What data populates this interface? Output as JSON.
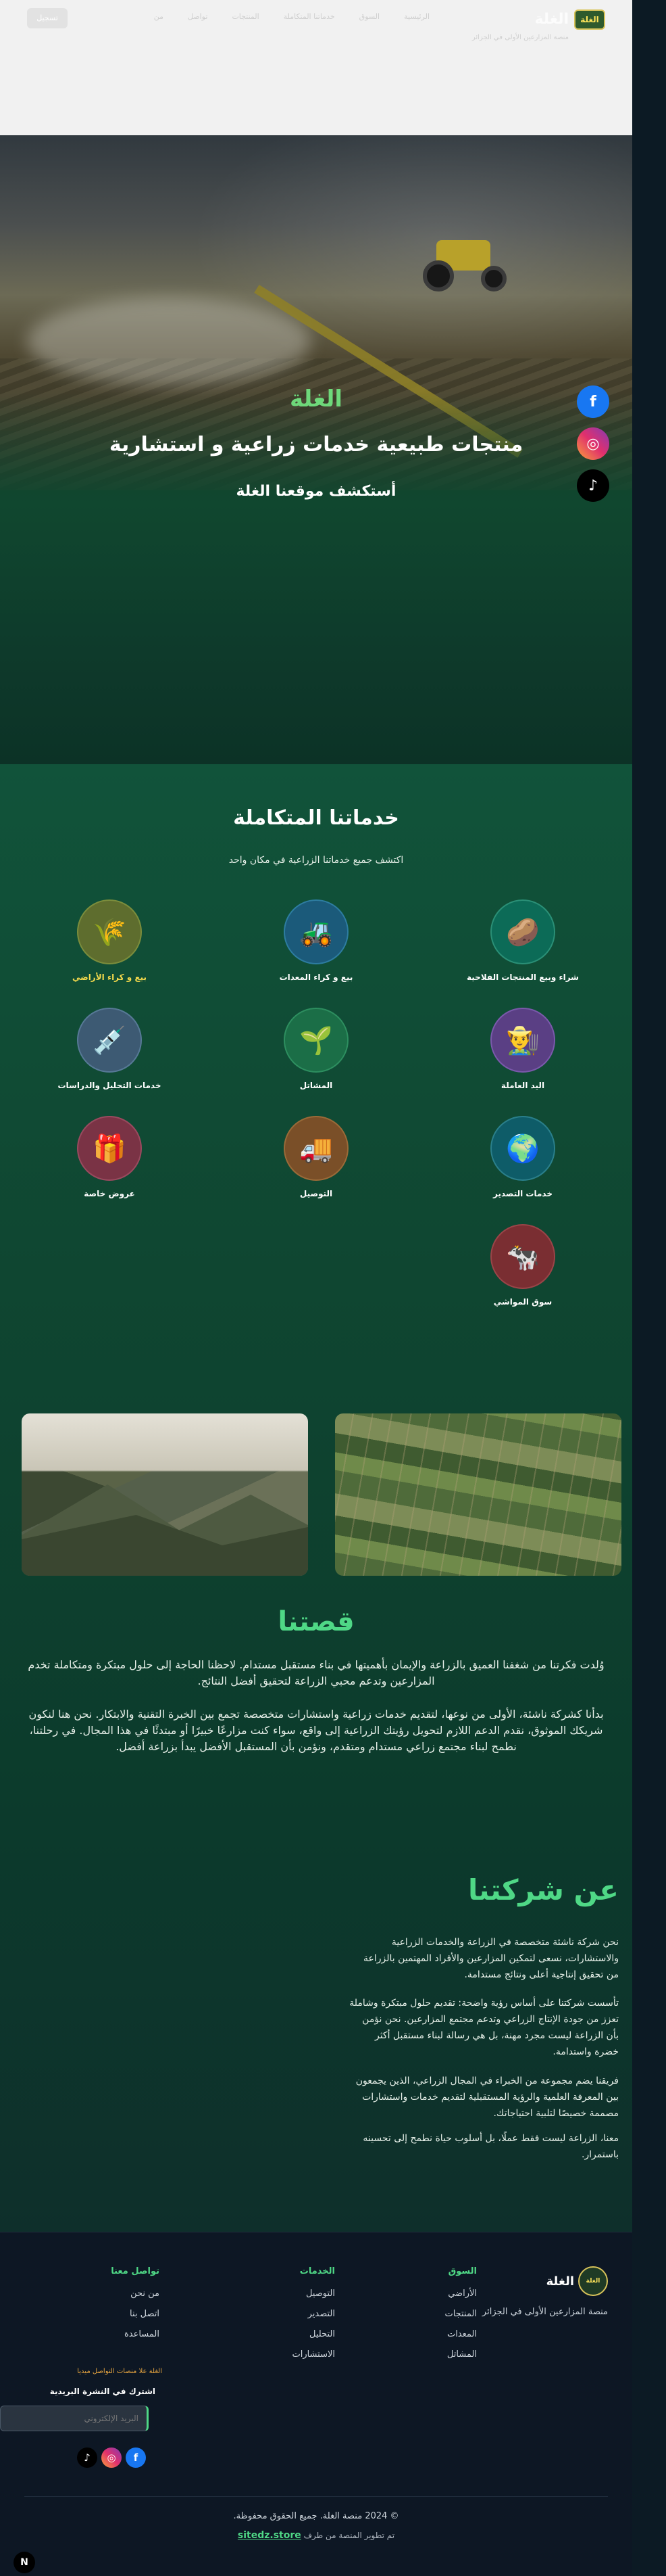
{
  "header": {
    "brand_name": "الغلة",
    "brand_logo_text": "الغلة",
    "brand_tagline": "منصة المزارعين الأولى في الجزائر",
    "nav": [
      "الرئيسية",
      "السوق",
      "خدماتنا المتكاملة",
      "المنتجات",
      "تواصل",
      "من"
    ],
    "cta": "تسجيل"
  },
  "hero": {
    "eyebrow": "الغلة",
    "title": "منتجات طبيعية خدمات زراعية و استشارية",
    "subtitle": "أستكشف موقعنا الغلة"
  },
  "social": {
    "facebook": "f",
    "instagram": "◎",
    "tiktok": "♪"
  },
  "services": {
    "title": "خدماتنا المتكاملة",
    "subtitle": "اكتشف جميع خدماتنا الزراعية في مكان واحد",
    "items": [
      {
        "label": "شراء وبيع المنتجات الفلاحية",
        "icon": "potato-icon",
        "glyph": "🥔",
        "color": "teal"
      },
      {
        "label": "بيع و كراء المعدات",
        "icon": "tractor-icon",
        "glyph": "🚜",
        "color": "blue"
      },
      {
        "label": "بيع و كراء الأراضي",
        "icon": "grain-icon",
        "glyph": "🌾",
        "color": "olive"
      },
      {
        "label": "اليد العاملة",
        "icon": "farmer-icon",
        "glyph": "👨‍🌾",
        "color": "purple"
      },
      {
        "label": "المشاتل",
        "icon": "seedling-icon",
        "glyph": "🌱",
        "color": "green"
      },
      {
        "label": "خدمات التحليل والدراسات",
        "icon": "syringe-icon",
        "glyph": "💉",
        "color": "slate"
      },
      {
        "label": "خدمات التصدير",
        "icon": "globe-icon",
        "glyph": "🌍",
        "color": "ocean"
      },
      {
        "label": "التوصيل",
        "icon": "truck-icon",
        "glyph": "🚚",
        "color": "brown"
      },
      {
        "label": "عروض خاصة",
        "icon": "gift-icon",
        "glyph": "🎁",
        "color": "rose"
      },
      {
        "label": "سوق المواشي",
        "icon": "cow-icon",
        "glyph": "🐄",
        "color": "red"
      }
    ]
  },
  "story": {
    "title": "قصتنا",
    "p1": "وُلدت فكرتنا من شغفنا العميق بالزراعة والإيمان بأهميتها في بناء مستقبل مستدام. لاحظنا الحاجة إلى حلول مبتكرة ومتكاملة تخدم المزارعين وتدعم محبي الزراعة لتحقيق أفضل النتائج.",
    "p2": "بدأنا كشركة ناشئة، الأولى من نوعها، لتقديم خدمات زراعية واستشارات متخصصة تجمع بين الخبرة التقنية والابتكار. نحن هنا لنكون شريكك الموثوق، نقدم الدعم اللازم لتحويل رؤيتك الزراعية إلى واقع، سواء كنت مزارعًا خبيرًا أو مبتدئًا في هذا المجال. في رحلتنا، نطمح لبناء مجتمع زراعي مستدام ومتقدم، ونؤمن بأن المستقبل الأفضل يبدأ بزراعة أفضل."
  },
  "about": {
    "title": "عن شركتنا",
    "p1": "نحن شركة ناشئة متخصصة في الزراعة والخدمات الزراعية والاستشارات، نسعى لتمكين المزارعين والأفراد المهتمين بالزراعة من تحقيق إنتاجية أعلى ونتائج مستدامة.",
    "p2": "تأسست شركتنا على أساس رؤية واضحة: تقديم حلول مبتكرة وشاملة تعزز من جودة الإنتاج الزراعي وتدعم مجتمع المزارعين. نحن نؤمن بأن الزراعة ليست مجرد مهنة، بل هي رسالة لبناء مستقبل أكثر خضرة واستدامة.",
    "p3": "فريقنا يضم مجموعة من الخبراء في المجال الزراعي، الذين يجمعون بين المعرفة العلمية والرؤية المستقبلية لتقديم خدمات واستشارات مصممة خصيصًا لتلبية احتياجاتك.",
    "p4": "معنا، الزراعة ليست فقط عملًا، بل أسلوب حياة نطمح إلى تحسينه باستمرار."
  },
  "footer": {
    "logo_text": "الغلة",
    "name": "الغلة",
    "tagline": "منصة المزارعين الأولى في الجزائر",
    "market": {
      "heading": "السوق",
      "links": [
        "الأراضي",
        "المنتجات",
        "المعدات",
        "المشاتل"
      ]
    },
    "services": {
      "heading": "الخدمات",
      "links": [
        "التوصيل",
        "التصدير",
        "التحليل",
        "الاستشارات"
      ]
    },
    "contact": {
      "heading": "تواصل معنا",
      "links": [
        "من نحن",
        "اتصل بنا",
        "المساعدة"
      ]
    },
    "promo": "الغلة علا منصات التواصل ميديا",
    "newsletter_heading": "اشترك في النشرة البريدية",
    "email_placeholder": "البريد الإلكتروني",
    "copyright": "© 2024 منصة الغلة. جميع الحقوق محفوظة.",
    "credit_prefix": "تم تطوير المنصة من طرف",
    "credit_link": "sitedz.store"
  },
  "misc": {
    "fab": "N"
  }
}
